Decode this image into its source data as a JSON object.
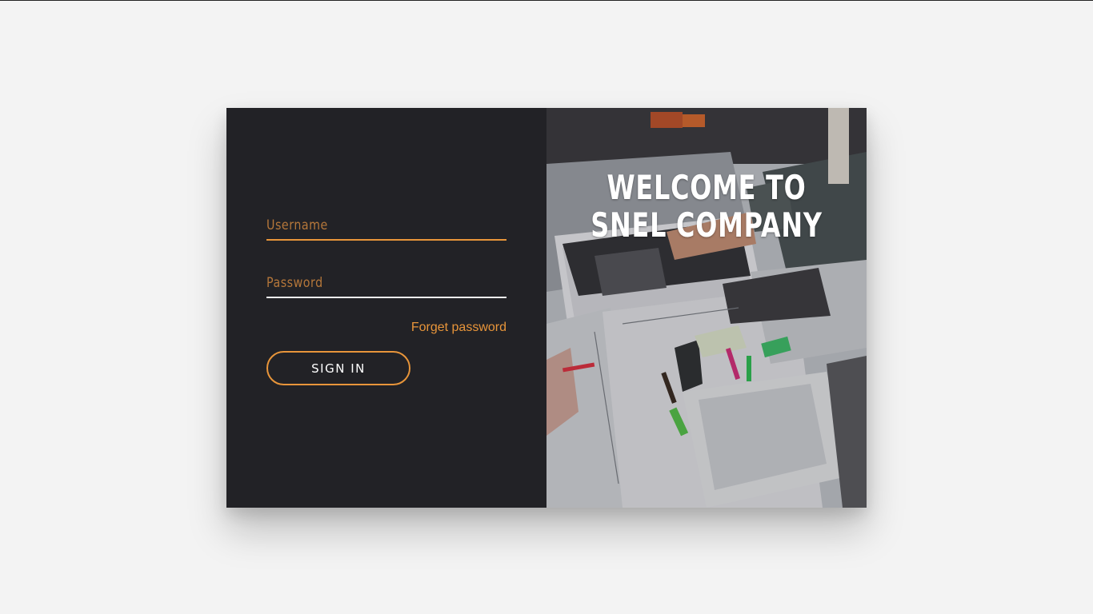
{
  "login": {
    "username_placeholder": "Username",
    "password_placeholder": "Password",
    "forgot_label": "Forget password",
    "signin_label": "SIGN IN"
  },
  "hero": {
    "title": "WELCOME TO SNEL COMPANY",
    "image": "workspace-photo"
  },
  "colors": {
    "accent": "#e8953a",
    "panel": "#222226",
    "page_background": "#f3f3f3"
  }
}
